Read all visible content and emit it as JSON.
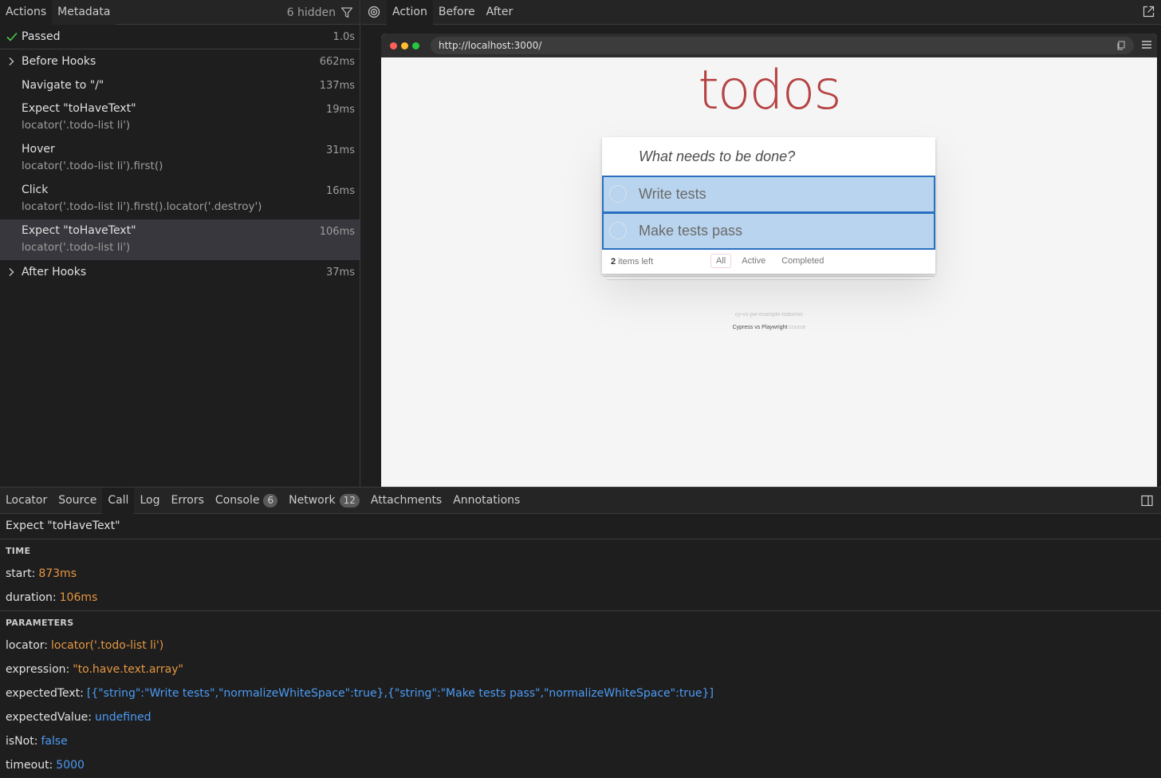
{
  "actions_panel": {
    "tabs": [
      "Actions",
      "Metadata"
    ],
    "hidden_label": "6 hidden",
    "status": {
      "label": "Passed",
      "time": "1.0s"
    },
    "rows": [
      {
        "title": "Before Hooks",
        "sub": "",
        "time": "662ms",
        "expandable": true
      },
      {
        "title": "Navigate to \"/\"",
        "sub": "",
        "time": "137ms"
      },
      {
        "title": "Expect \"toHaveText\"",
        "sub": "locator('.todo-list li')",
        "time": "19ms"
      },
      {
        "title": "Hover",
        "sub": "locator('.todo-list li').first()",
        "time": "31ms"
      },
      {
        "title": "Click",
        "sub": "locator('.todo-list li').first().locator('.destroy')",
        "time": "16ms"
      },
      {
        "title": "Expect \"toHaveText\"",
        "sub": "locator('.todo-list li')",
        "time": "106ms",
        "selected": true
      },
      {
        "title": "After Hooks",
        "sub": "",
        "time": "37ms",
        "expandable": true
      }
    ]
  },
  "snapshot_panel": {
    "tabs": [
      "Action",
      "Before",
      "After"
    ],
    "url": "http://localhost:3000/"
  },
  "todo_app": {
    "title": "todos",
    "placeholder": "What needs to be done?",
    "items": [
      "Write tests",
      "Make tests pass"
    ],
    "items_left_count": "2",
    "items_left_label": "items left",
    "filters": [
      "All",
      "Active",
      "Completed"
    ],
    "info_line1": "cy-vs-pw-example-todomvc",
    "info_line2_a": "Cypress vs Playwright",
    "info_line2_b": "course"
  },
  "bottom_panel": {
    "tabs": [
      {
        "label": "Locator"
      },
      {
        "label": "Source"
      },
      {
        "label": "Call",
        "selected": true
      },
      {
        "label": "Log"
      },
      {
        "label": "Errors"
      },
      {
        "label": "Console",
        "count": "6"
      },
      {
        "label": "Network",
        "count": "12"
      },
      {
        "label": "Attachments"
      },
      {
        "label": "Annotations"
      }
    ],
    "call_title": "Expect \"toHaveText\"",
    "time_heading": "TIME",
    "start_key": "start:",
    "start_val": "873ms",
    "duration_key": "duration:",
    "duration_val": "106ms",
    "params_heading": "PARAMETERS",
    "params": [
      {
        "key": "locator:",
        "value": "locator('.todo-list li')",
        "color": "orange"
      },
      {
        "key": "expression:",
        "value": "\"to.have.text.array\"",
        "color": "orange"
      },
      {
        "key": "expectedText:",
        "value": "[{\"string\":\"Write tests\",\"normalizeWhiteSpace\":true},{\"string\":\"Make tests pass\",\"normalizeWhiteSpace\":true}]",
        "color": "blue"
      },
      {
        "key": "expectedValue:",
        "value": "undefined",
        "color": "blue"
      },
      {
        "key": "isNot:",
        "value": "false",
        "color": "blue"
      },
      {
        "key": "timeout:",
        "value": "5000",
        "color": "blue"
      }
    ]
  },
  "colors": {
    "background": "#1e1e1e",
    "accent_orange": "#e59642",
    "accent_blue": "#4c9bf5",
    "passed_green": "#4ec94e",
    "todo_red": "#af2f2f"
  }
}
